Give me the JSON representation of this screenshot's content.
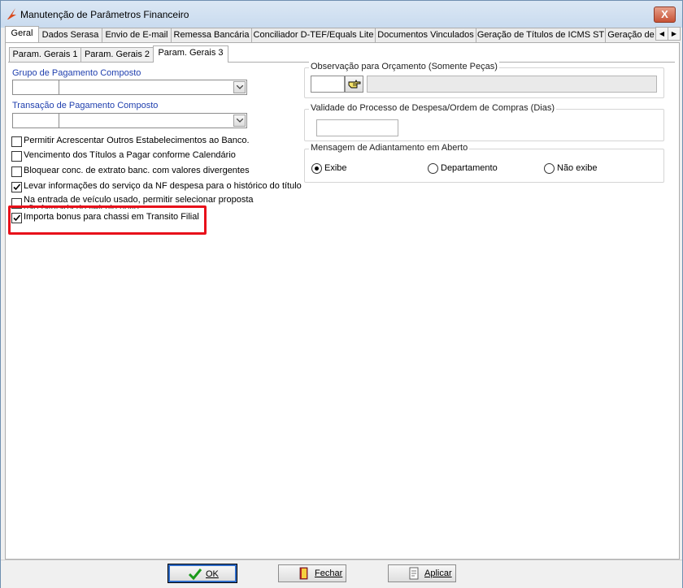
{
  "window": {
    "title": "Manutenção de Parâmetros Financeiro",
    "close_label": "X"
  },
  "tabs": [
    {
      "label": "Geral",
      "active": true
    },
    {
      "label": "Dados Serasa",
      "active": false
    },
    {
      "label": "Envio de E-mail",
      "active": false
    },
    {
      "label": "Remessa Bancária",
      "active": false
    },
    {
      "label": "Conciliador D-TEF/Equals Lite",
      "active": false
    },
    {
      "label": "Documentos Vinculados",
      "active": false
    },
    {
      "label": "Geração de Títulos de ICMS ST",
      "active": false
    },
    {
      "label": "Geração de",
      "active": false
    }
  ],
  "tab_scroll": {
    "left": "◀",
    "right": "▶"
  },
  "subtabs": [
    {
      "label": "Param. Gerais 1",
      "active": false
    },
    {
      "label": "Param. Gerais 2",
      "active": false
    },
    {
      "label": "Param. Gerais 3",
      "active": true
    }
  ],
  "left": {
    "grupo_label": "Grupo de Pagamento Composto",
    "grupo_code": "",
    "grupo_desc": "",
    "transacao_label": "Transação de Pagamento Composto",
    "transacao_code": "",
    "transacao_desc": "",
    "checkboxes": [
      {
        "label": "Permitir Acrescentar Outros Estabelecimentos ao Banco.",
        "checked": false
      },
      {
        "label": "Vencimento dos Títulos a Pagar conforme Calendário",
        "checked": false
      },
      {
        "label": "Bloquear conc. de extrato banc. com valores divergentes",
        "checked": false
      },
      {
        "label": "Levar informações do serviço da NF despesa para o histórico do título",
        "checked": true
      },
      {
        "label": "Na entrada de veículo usado, permitir selecionar proposta",
        "label2": "não faturada do veículo novo.",
        "checked": false
      },
      {
        "label": "Importa bonus para chassi em Transito Filial",
        "checked": true
      }
    ]
  },
  "right": {
    "observacao_title": "Observação para Orçamento (Somente Peças)",
    "observacao_code": "",
    "observacao_desc": "",
    "validade_title": "Validade do Processo de Despesa/Ordem de Compras (Dias)",
    "validade_value": "",
    "mensagem_title": "Mensagem de Adiantamento em Aberto",
    "radios": [
      {
        "label": "Exibe",
        "selected": true
      },
      {
        "label": "Departamento",
        "selected": false
      },
      {
        "label": "Não exibe",
        "selected": false
      }
    ]
  },
  "footer": {
    "ok_label": "OK",
    "fechar_label": "Fechar",
    "aplicar_label": "Aplicar"
  },
  "colors": {
    "highlight": "#e8101a",
    "label_blue": "#1f3fae",
    "default_border": "#2e6bc7"
  }
}
